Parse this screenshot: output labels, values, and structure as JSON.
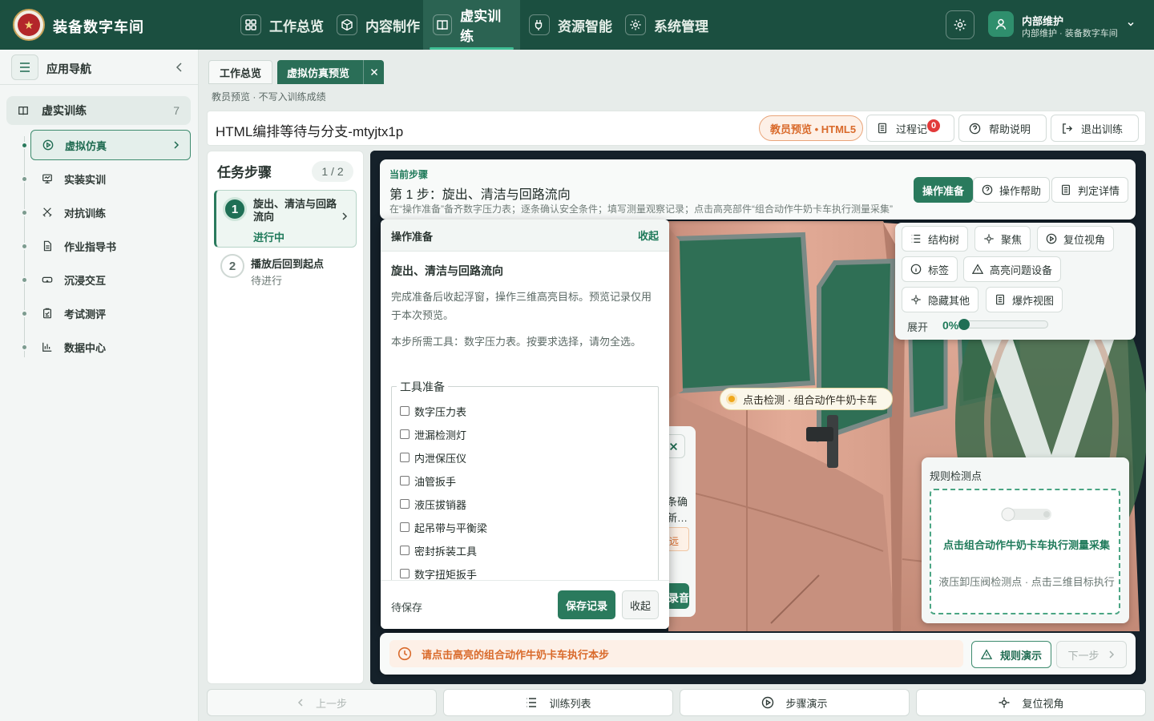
{
  "app": {
    "title": "装备数字车间"
  },
  "topnav": {
    "tabs": [
      {
        "label": "工作总览",
        "icon": "grid-icon"
      },
      {
        "label": "内容制作",
        "icon": "cube-icon"
      },
      {
        "label": "虚实训练",
        "icon": "book-icon"
      },
      {
        "label": "资源智能",
        "icon": "plug-icon"
      },
      {
        "label": "系统管理",
        "icon": "gear-icon"
      }
    ],
    "active": "虚实训练"
  },
  "user": {
    "name": "内部维护",
    "subtitle": "内部维护 · 装备数字车间"
  },
  "sidebar": {
    "title": "应用导航",
    "group": {
      "label": "虚实训练",
      "count": "7"
    },
    "items": [
      {
        "label": "虚拟仿真",
        "icon": "play-circle-icon"
      },
      {
        "label": "实装实训",
        "icon": "monitor-icon"
      },
      {
        "label": "对抗训练",
        "icon": "swords-icon"
      },
      {
        "label": "作业指导书",
        "icon": "document-icon"
      },
      {
        "label": "沉浸交互",
        "icon": "vr-headset-icon"
      },
      {
        "label": "考试测评",
        "icon": "exam-icon"
      },
      {
        "label": "数据中心",
        "icon": "bar-chart-icon"
      }
    ],
    "active": "虚拟仿真"
  },
  "pagetabs": [
    "工作总览",
    "虚拟仿真预览"
  ],
  "preview_note": "教员预览 · 不写入训练成绩",
  "header": {
    "title": "HTML编排等待与分支-mtyjtx1p",
    "badge": "教员预览 • HTML5",
    "record_label": "过程记",
    "record_count": "0",
    "help_label": "帮助说明",
    "exit_label": "退出训练"
  },
  "task": {
    "title": "任务步骤",
    "progress": "1 / 2",
    "steps": [
      {
        "num": "1",
        "title": "旋出、清洁与回路流向",
        "status": "进行中"
      },
      {
        "num": "2",
        "title": "播放后回到起点",
        "status": "待进行"
      }
    ]
  },
  "current_step": {
    "label": "当前步骤",
    "title": "第 1 步：旋出、清洁与回路流向",
    "desc": "在“操作准备”备齐数字压力表；逐条确认安全条件；填写测量观察记录；点击高亮部件“组合动作牛奶卡车执行测量采集”",
    "buttons": [
      "操作准备",
      "操作帮助",
      "判定详情"
    ]
  },
  "toolbox": {
    "row1": [
      "结构树",
      "聚焦",
      "复位视角"
    ],
    "row2": [
      "标签",
      "高亮问题设备"
    ],
    "row3": [
      "隐藏其他",
      "爆炸视图"
    ],
    "expand_label": "展开",
    "expand_value": "0%",
    "expand_fraction": 0
  },
  "hotspot": {
    "label": "点击检测 · 组合动作牛奶卡车"
  },
  "behind_popup": {
    "text1": "条确",
    "text2": "新…",
    "warn": "远",
    "button": "录音"
  },
  "prep": {
    "title": "操作准备",
    "collapse": "收起",
    "name": "旋出、清洁与回路流向",
    "p1": "完成准备后收起浮窗，操作三维高亮目标。预览记录仅用于本次预览。",
    "p2": "本步所需工具：数字压力表。按要求选择，请勿全选。",
    "legend": "工具准备",
    "tools": [
      "数字压力表",
      "泄漏检测灯",
      "内泄保压仪",
      "油管扳手",
      "液压拔销器",
      "起吊带与平衡梁",
      "密封拆装工具",
      "数字扭矩扳手"
    ],
    "status": "待保存",
    "save": "保存记录",
    "fold": "收起"
  },
  "rule": {
    "title": "规则检测点",
    "action": "点击组合动作牛奶卡车执行测量采集",
    "detail": "液压卸压阀检测点 · 点击三维目标执行"
  },
  "notice": {
    "text": "请点击高亮的组合动作牛奶卡车执行本步",
    "demo": "规则演示",
    "next": "下一步"
  },
  "bottomnav": [
    "上一步",
    "训练列表",
    "步骤演示",
    "复位视角"
  ],
  "colors": {
    "brand": "#1b4f40",
    "accent": "#2a7a5d",
    "warning": "#d96a2b",
    "truck": "#d9a390"
  }
}
